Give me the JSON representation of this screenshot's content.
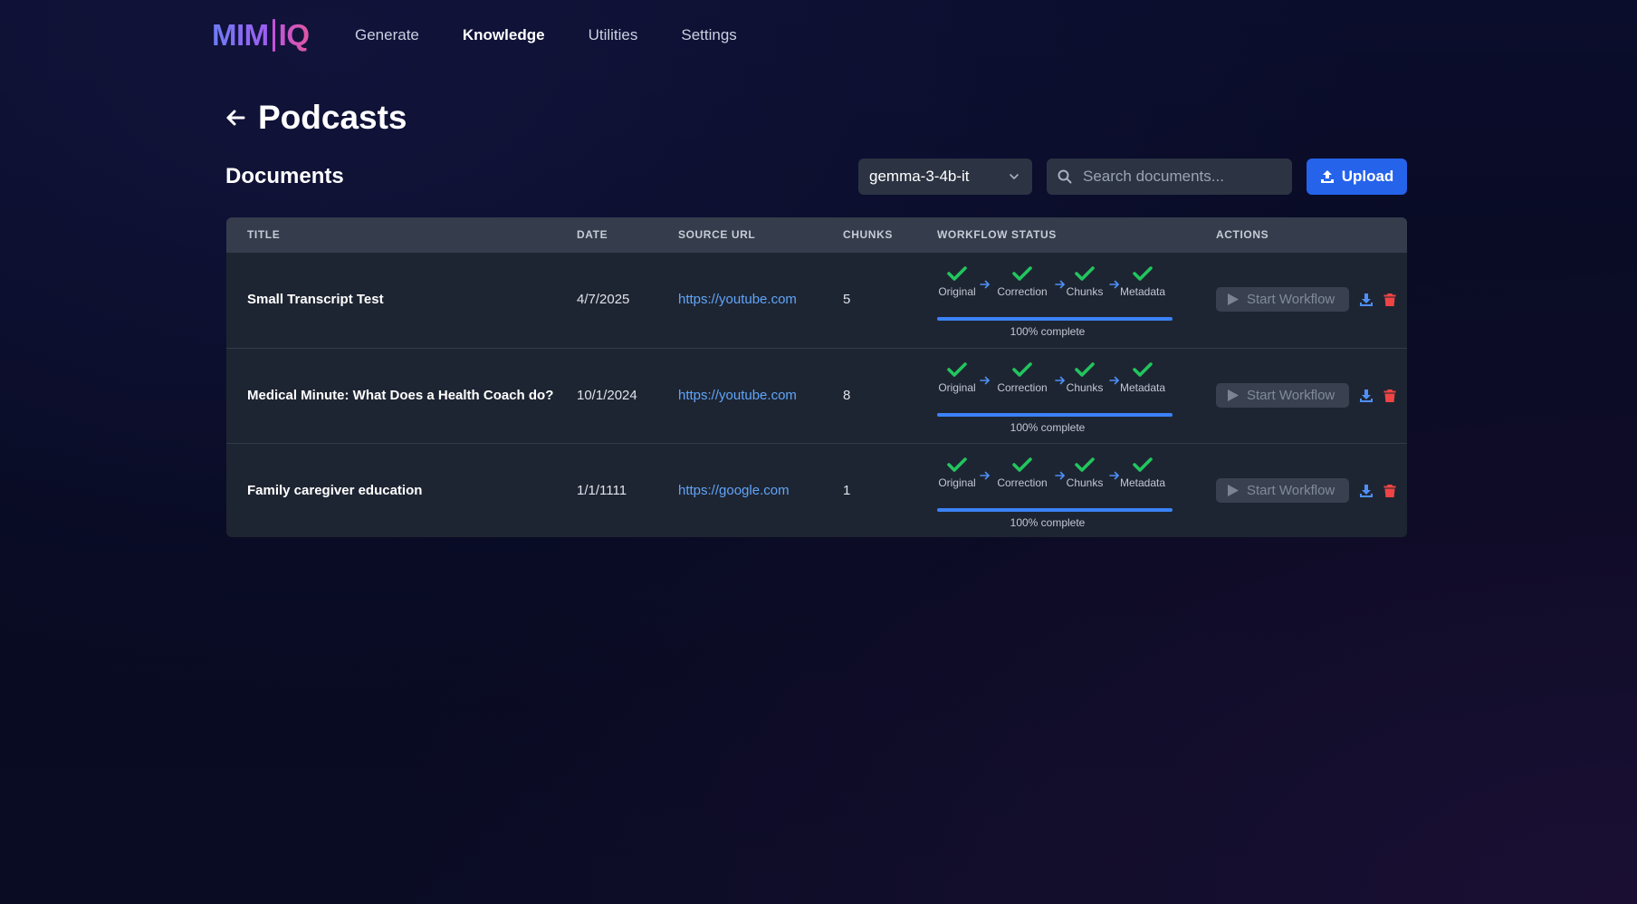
{
  "brand": {
    "logo_left": "MIM",
    "logo_right": "IQ"
  },
  "nav": {
    "items": [
      {
        "label": "Generate",
        "active": false
      },
      {
        "label": "Knowledge",
        "active": true
      },
      {
        "label": "Utilities",
        "active": false
      },
      {
        "label": "Settings",
        "active": false
      }
    ]
  },
  "page": {
    "title": "Podcasts",
    "section_title": "Documents"
  },
  "toolbar": {
    "model_select_value": "gemma-3-4b-it",
    "search_placeholder": "Search documents...",
    "upload_label": "Upload"
  },
  "table": {
    "headers": {
      "title": "TITLE",
      "date": "DATE",
      "source_url": "SOURCE URL",
      "chunks": "CHUNKS",
      "workflow_status": "WORKFLOW STATUS",
      "actions": "ACTIONS"
    },
    "workflow_steps": [
      "Original",
      "Correction",
      "Chunks",
      "Metadata"
    ],
    "start_workflow_label": "Start Workflow",
    "rows": [
      {
        "title": "Small Transcript Test",
        "date": "4/7/2025",
        "source_url": "https://youtube.com",
        "chunks": "5",
        "progress_percent": 100,
        "progress_text": "100% complete"
      },
      {
        "title": "Medical Minute: What Does a Health Coach do?",
        "date": "10/1/2024",
        "source_url": "https://youtube.com",
        "chunks": "8",
        "progress_percent": 100,
        "progress_text": "100% complete"
      },
      {
        "title": "Family caregiver education",
        "date": "1/1/1111",
        "source_url": "https://google.com",
        "chunks": "1",
        "progress_percent": 100,
        "progress_text": "100% complete"
      }
    ]
  },
  "icons": {
    "back": "arrow-left-icon",
    "dropdown": "chevron-down-icon",
    "search": "search-icon",
    "upload": "upload-icon",
    "step_done": "check-icon",
    "step_arrow": "arrow-right-icon",
    "play": "play-icon",
    "download": "download-icon",
    "delete": "trash-icon"
  },
  "colors": {
    "accent": "#2563eb",
    "link": "#60a5fa",
    "success": "#22c55e",
    "danger": "#ef4444",
    "progress": "#3b82f6"
  }
}
